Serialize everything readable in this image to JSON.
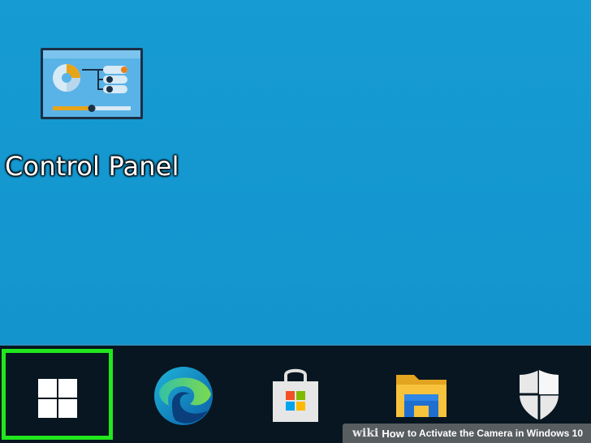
{
  "desktop": {
    "shortcuts": [
      {
        "label": "Control Panel",
        "icon": "control-panel-icon"
      }
    ]
  },
  "taskbar": {
    "items": [
      {
        "name": "start-button",
        "icon": "windows-logo-icon",
        "highlighted": true,
        "highlight_color": "#22e61e"
      },
      {
        "name": "edge-button",
        "icon": "microsoft-edge-icon"
      },
      {
        "name": "store-button",
        "icon": "microsoft-store-icon"
      },
      {
        "name": "file-explorer-button",
        "icon": "folder-icon"
      },
      {
        "name": "windows-security-button",
        "icon": "shield-icon"
      }
    ]
  },
  "watermark": {
    "brand": "wiki",
    "how": "How",
    "title": "to Activate the Camera in Windows 10"
  },
  "colors": {
    "desktop_background": "#1496cf",
    "taskbar_background": "#071620",
    "highlight": "#22e61e"
  }
}
